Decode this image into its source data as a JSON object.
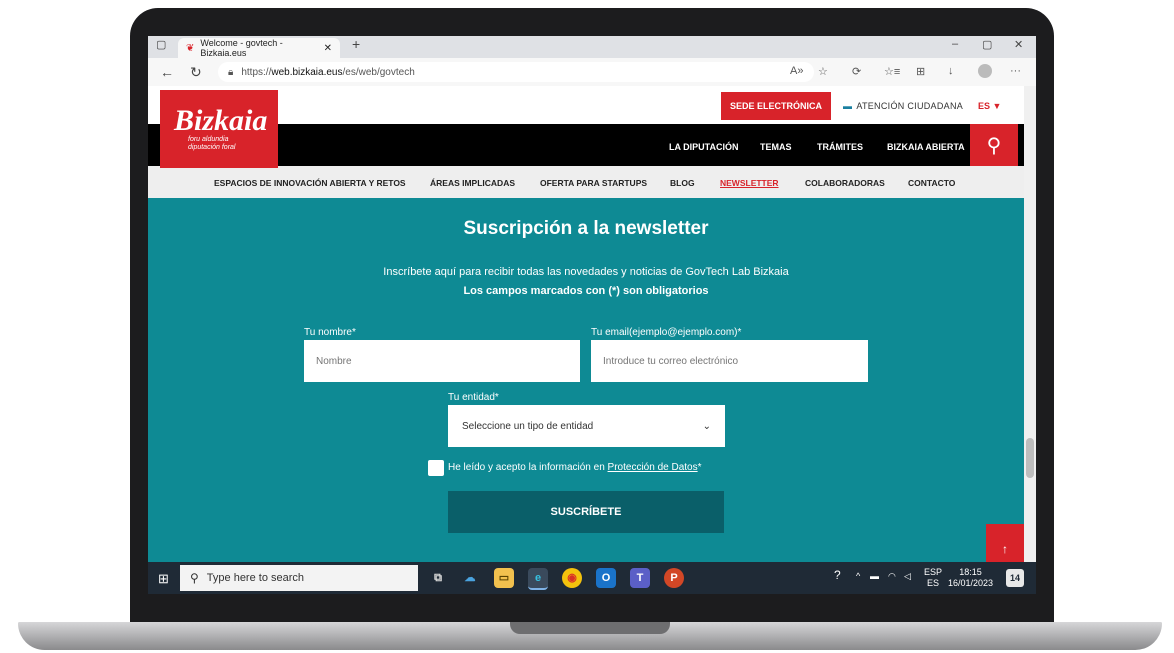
{
  "browser": {
    "tab_title": "Welcome - govtech - Bizkaia.eus",
    "url_prefix": "https://",
    "url_host": "web.bizkaia.eus",
    "url_path": "/es/web/govtech"
  },
  "header": {
    "logo_text": "Bizkaia",
    "logo_sub_line1": "foru aldundia",
    "logo_sub_line2": "diputación foral",
    "sede_label": "SEDE ELECTRÓNICA",
    "atencion_label": "ATENCIÓN CIUDADANA",
    "lang_label": "ES ▼",
    "main_nav": [
      "LA DIPUTACIÓN",
      "TEMAS",
      "TRÁMITES",
      "BIZKAIA ABIERTA"
    ]
  },
  "subnav": {
    "items": [
      "ESPACIOS DE INNOVACIÓN ABIERTA Y RETOS",
      "ÁREAS IMPLICADAS",
      "OFERTA PARA STARTUPS",
      "BLOG",
      "NEWSLETTER",
      "COLABORADORAS",
      "CONTACTO"
    ],
    "active": "NEWSLETTER"
  },
  "form": {
    "title": "Suscripción a la newsletter",
    "description": "Inscríbete aquí para recibir todas las novedades y noticias de GovTech Lab Bizkaia",
    "required_note": "Los campos marcados con (*) son obligatorios",
    "name_label": "Tu nombre*",
    "name_placeholder": "Nombre",
    "email_label": "Tu email(ejemplo@ejemplo.com)*",
    "email_placeholder": "Introduce tu correo electrónico",
    "entity_label": "Tu entidad*",
    "entity_selected": "Seleccione un tipo de entidad",
    "consent_prefix": "He leído y acepto la información en ",
    "consent_link": "Protección de Datos",
    "consent_suffix": "*",
    "submit_label": "SUSCRÍBETE",
    "to_top": "↑"
  },
  "taskbar": {
    "search_placeholder": "Type here to search",
    "lang_top": "ESP",
    "lang_bottom": "ES",
    "time": "18:15",
    "date": "16/01/2023",
    "notifications": "14"
  },
  "colors": {
    "brand_red": "#d8232a",
    "teal": "#0e8a94",
    "button_teal": "#0a5f69"
  }
}
